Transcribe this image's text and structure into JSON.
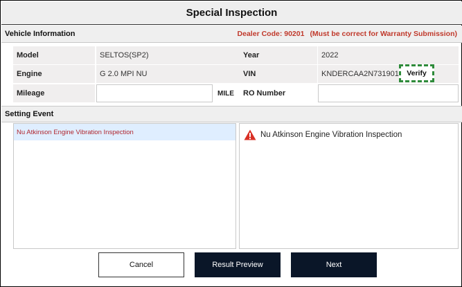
{
  "title": "Special Inspection",
  "vehicle_section": {
    "label": "Vehicle Information",
    "dealer_code_label": "Dealer Code: 90201",
    "dealer_note": "(Must be correct for Warranty Submission)"
  },
  "fields": {
    "model_label": "Model",
    "model_value": "SELTOS(SP2)",
    "year_label": "Year",
    "year_value": "2022",
    "engine_label": "Engine",
    "engine_value": "G 2.0 MPI NU",
    "vin_label": "VIN",
    "vin_value": "KNDERCAA2N7319015",
    "verify_label": "Verify",
    "mileage_label": "Mileage",
    "mileage_value": "",
    "mileage_unit": "MILE",
    "ro_label": "RO Number",
    "ro_value": ""
  },
  "setting_event": {
    "label": "Setting Event",
    "items": [
      "Nu Atkinson Engine Vibration Inspection"
    ],
    "detail_title": "Nu Atkinson Engine Vibration Inspection"
  },
  "buttons": {
    "cancel": "Cancel",
    "result_preview": "Result Preview",
    "next": "Next"
  },
  "colors": {
    "dealer_text": "#c0392b",
    "verify_highlight": "#2e8b3a",
    "selected_item_bg": "#dfeeff",
    "selected_item_text": "#b0262e",
    "dark_button": "#0a1628",
    "warning_icon": "#d93025"
  },
  "icons": {
    "detail_icon": "warning-triangle-icon"
  }
}
